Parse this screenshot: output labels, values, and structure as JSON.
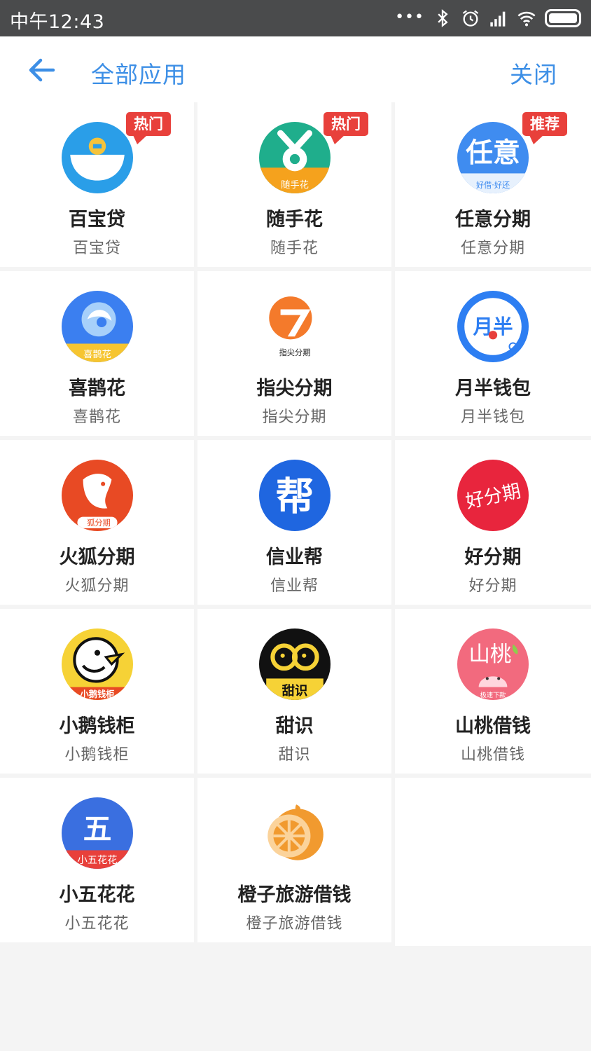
{
  "status_bar": {
    "time": "中午12:43",
    "dots": "•••"
  },
  "header": {
    "title": "全部应用",
    "close_label": "关闭"
  },
  "apps": [
    {
      "name": "百宝贷",
      "subtitle": "百宝贷",
      "badge": "热门",
      "icon": "baibaodai-icon"
    },
    {
      "name": "随手花",
      "subtitle": "随手花",
      "badge": "热门",
      "icon": "suishouhua-icon",
      "icon_text": "随手花"
    },
    {
      "name": "任意分期",
      "subtitle": "任意分期",
      "badge": "推荐",
      "icon": "renyi-icon",
      "icon_text": "任意",
      "icon_small": "好借·好还"
    },
    {
      "name": "喜鹊花",
      "subtitle": "喜鹊花",
      "icon": "xiquehua-icon",
      "icon_text": "喜鹊花"
    },
    {
      "name": "指尖分期",
      "subtitle": "指尖分期",
      "icon": "zhijian-icon",
      "icon_text": "指尖分期"
    },
    {
      "name": "月半钱包",
      "subtitle": "月半钱包",
      "icon": "yueban-icon",
      "icon_text": "月半"
    },
    {
      "name": "火狐分期",
      "subtitle": "火狐分期",
      "icon": "huohu-icon",
      "icon_text": "狐分期"
    },
    {
      "name": "信业帮",
      "subtitle": "信业帮",
      "icon": "xinyebang-icon",
      "icon_text": "帮"
    },
    {
      "name": "好分期",
      "subtitle": "好分期",
      "icon": "haofenqi-icon",
      "icon_text": "好分期"
    },
    {
      "name": "小鹅钱柜",
      "subtitle": "小鹅钱柜",
      "icon": "xiaoe-icon",
      "icon_text": "小鹅钱柜"
    },
    {
      "name": "甜识",
      "subtitle": "甜识",
      "icon": "tianshi-icon",
      "icon_text": "甜识"
    },
    {
      "name": "山桃借钱",
      "subtitle": "山桃借钱",
      "icon": "shantao-icon",
      "icon_text": "山桃",
      "icon_small": "极速下款"
    },
    {
      "name": "小五花花",
      "subtitle": "小五花花",
      "icon": "xiaowu-icon",
      "icon_text": "五",
      "icon_small": "小五花花"
    },
    {
      "name": "橙子旅游借钱",
      "subtitle": "橙子旅游借钱",
      "icon": "chengzi-icon"
    }
  ]
}
